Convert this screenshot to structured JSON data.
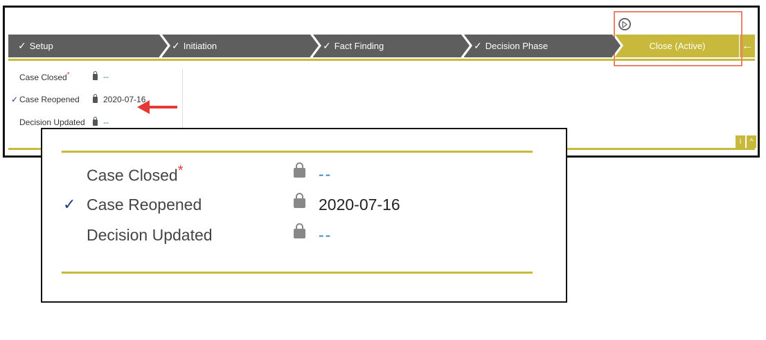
{
  "stages": [
    {
      "label": "Setup",
      "check": "✓"
    },
    {
      "label": "Initiation",
      "check": "✓"
    },
    {
      "label": "Fact Finding",
      "check": "✓"
    },
    {
      "label": "Decision Phase",
      "check": "✓"
    },
    {
      "label": "Close (Active)"
    }
  ],
  "fields": [
    {
      "label": "Case Closed",
      "required_mark": "*",
      "value": "--",
      "checked": false
    },
    {
      "label": "Case Reopened",
      "check": "✓",
      "value": "2020-07-16",
      "checked": true
    },
    {
      "label": "Decision Updated",
      "value": "--",
      "checked": false
    }
  ],
  "buttons": {
    "back_icon": "←",
    "info_label": "i",
    "collapse_icon": "^"
  },
  "colors": {
    "accent": "#c8b83b",
    "stage_dark": "#5e5e5e",
    "link_blue": "#2e7bbd",
    "check_navy": "#1e3f78",
    "highlight": "#e8836a",
    "arrow_red": "#e53935"
  }
}
